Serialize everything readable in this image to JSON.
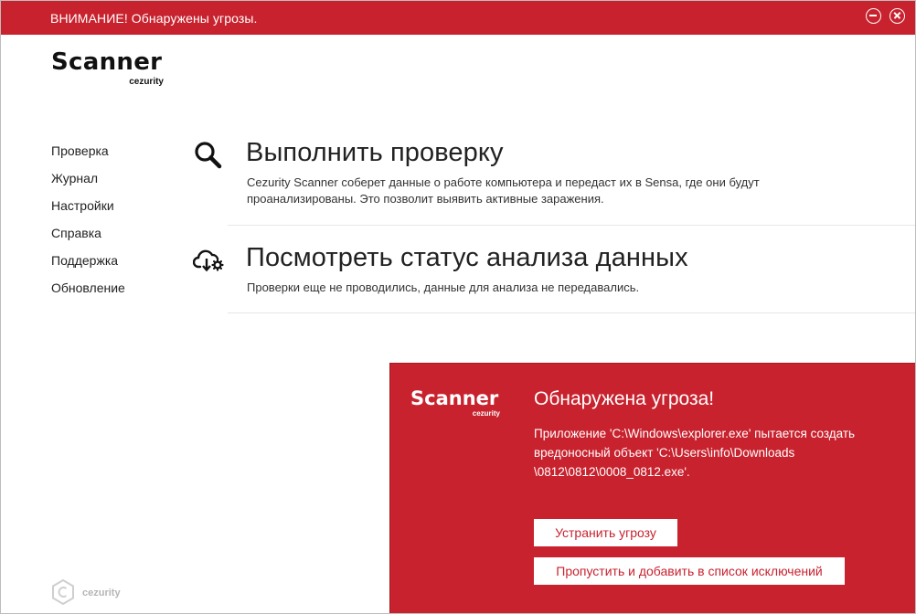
{
  "titlebar": {
    "title": "ВНИМАНИЕ! Обнаружены угрозы.",
    "minimize_icon": "minimize-circle-icon",
    "close_icon": "close-circle-icon",
    "background_color": "#c8222e"
  },
  "logo": {
    "brand": "Scanner",
    "sub": "cezurity"
  },
  "nav": {
    "items": [
      {
        "label": "Проверка"
      },
      {
        "label": "Журнал"
      },
      {
        "label": "Настройки"
      },
      {
        "label": "Справка"
      },
      {
        "label": "Поддержка"
      },
      {
        "label": "Обновление"
      }
    ]
  },
  "actions": {
    "scan": {
      "icon": "magnifier-icon",
      "heading": "Выполнить проверку",
      "description": "Cezurity Scanner соберет данные о работе компьютера и передаст их в Sensa, где они будут проанализированы. Это позволит выявить активные заражения."
    },
    "status": {
      "icon": "cloud-gear-icon",
      "heading": "Посмотреть статус анализа данных",
      "description": "Проверки еще не проводились, данные для анализа не передавались."
    }
  },
  "footer": {
    "logo_text": "cezurity",
    "logo_icon": "cezurity-hexagon-icon"
  },
  "alert": {
    "brand": "Scanner",
    "sub": "cezurity",
    "title": "Обнаружена угроза!",
    "message": "Приложение 'C:\\Windows\\explorer.exe' пытается создать вредоносный объект 'C:\\Users\\info\\Downloads \\0812\\0812\\0008_0812.exe'.",
    "fix_button": "Устранить угрозу",
    "skip_button": "Пропустить и добавить в список исключений",
    "background_color": "#c8222e"
  }
}
